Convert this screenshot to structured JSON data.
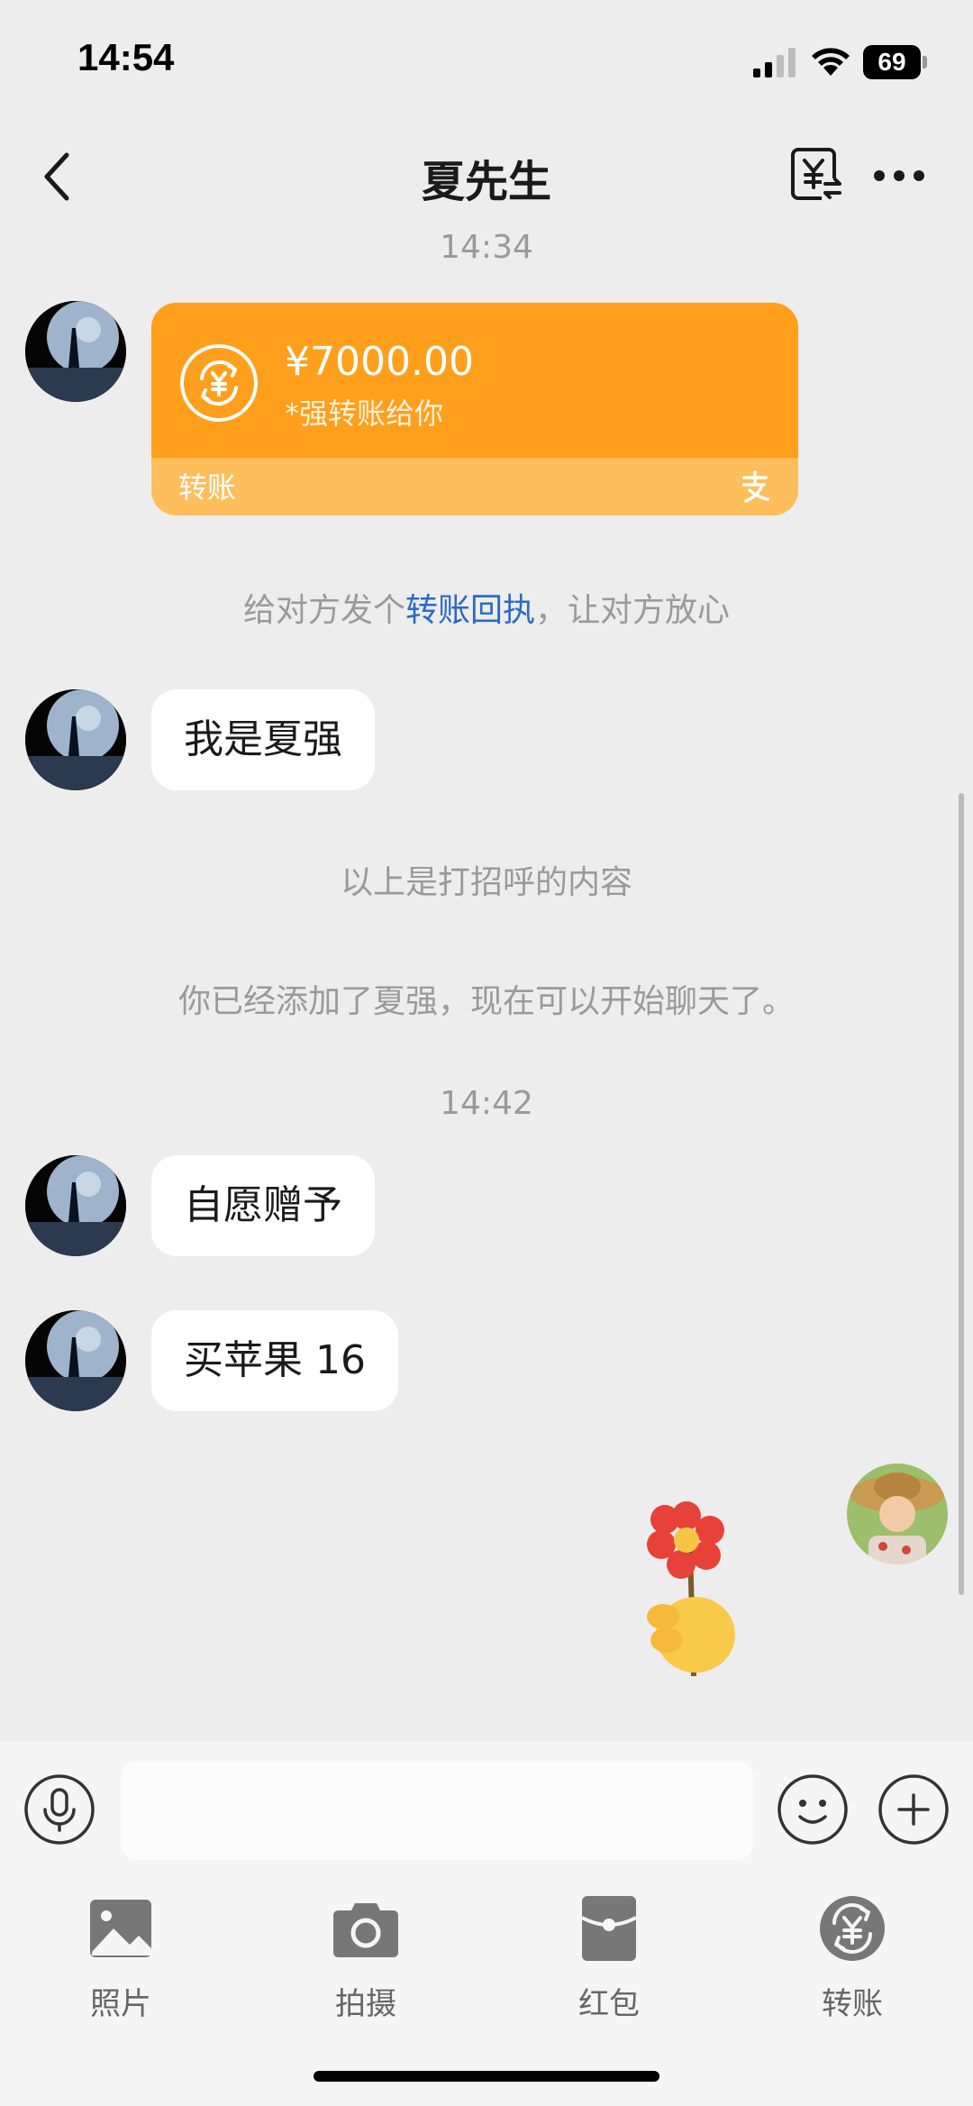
{
  "status_bar": {
    "time": "14:54",
    "battery": "69"
  },
  "nav": {
    "title": "夏先生"
  },
  "chat": {
    "time_1": "14:34",
    "transfer": {
      "amount": "¥7000.00",
      "note": "*强转账给你",
      "type_label": "转账"
    },
    "receipt_prompt": {
      "prefix": "给对方发个",
      "link": "转账回执",
      "suffix": "，让对方放心"
    },
    "msg_1": "我是夏强",
    "system_1": "以上是打招呼的内容",
    "system_2": "你已经添加了夏强，现在可以开始聊天了。",
    "time_2": "14:42",
    "msg_2": "自愿赠予",
    "msg_3": "买苹果 16"
  },
  "input": {
    "placeholder": ""
  },
  "tools": {
    "photo": "照片",
    "camera": "拍摄",
    "red_packet": "红包",
    "transfer": "转账"
  },
  "colors": {
    "transfer_card": "#FF9F1C",
    "link": "#2A6BC4",
    "red_packet": "#E0473A"
  },
  "icons": [
    "back-icon",
    "transfer-record-icon",
    "more-icon",
    "voice-icon",
    "emoji-icon",
    "plus-icon",
    "photo-icon",
    "camera-icon",
    "red-packet-icon",
    "transfer-icon"
  ]
}
